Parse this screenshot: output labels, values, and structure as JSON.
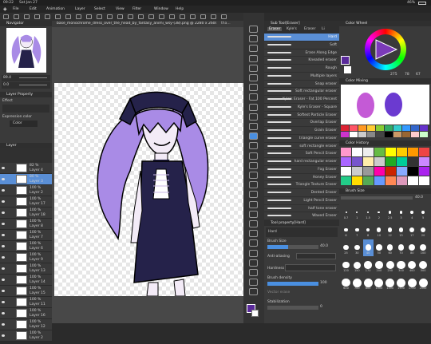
{
  "statusbar": {
    "time": "09:22",
    "date": "Sat Jan 27",
    "battery": "46%"
  },
  "menu": [
    "File",
    "Edit",
    "Animation",
    "Layer",
    "Select",
    "View",
    "Filter",
    "Window",
    "Help"
  ],
  "doc_tab": "base_monochrome_dress_over_the_head_by_fantasy_animi_wsy-(38).png @ 2280 x 2600 px, 96 dpi, 89.4%",
  "doc_tab2": "tha...",
  "navigator": {
    "title": "Navigator",
    "zoom": "89.4",
    "angle": "0.0"
  },
  "layer_property": {
    "title": "Layer Property",
    "effect": "Effect",
    "expression": "Expression color",
    "color": "Color"
  },
  "layers": {
    "title": "Layer",
    "items": [
      {
        "pct": "82 %",
        "name": "Layer 4"
      },
      {
        "pct": "80 %",
        "name": "Layer 3"
      },
      {
        "pct": "100 %",
        "name": "Layer 2"
      },
      {
        "pct": "100 %",
        "name": "Layer 17"
      },
      {
        "pct": "100 %",
        "name": "Layer 18"
      },
      {
        "pct": "100 %",
        "name": "Layer 8"
      },
      {
        "pct": "100 %",
        "name": "Layer 7"
      },
      {
        "pct": "100 %",
        "name": "Layer 6"
      },
      {
        "pct": "100 %",
        "name": "Layer 9"
      },
      {
        "pct": "100 %",
        "name": "Layer 13"
      },
      {
        "pct": "100 %",
        "name": "Layer 14"
      },
      {
        "pct": "100 %",
        "name": "Layer 15"
      },
      {
        "pct": "100 %",
        "name": "Layer 11"
      },
      {
        "pct": "100 %",
        "name": "Layer 16"
      },
      {
        "pct": "100 %",
        "name": "Layer 12"
      },
      {
        "pct": "100 %",
        "name": "Layer 2"
      }
    ]
  },
  "subtool": {
    "title": "Sub Tool[Eraser]",
    "tabs": [
      "Eraser",
      "Kyle's",
      "Eraser",
      "Li"
    ],
    "items": [
      "Hard",
      "Soft",
      "Erase Along Edge",
      "Kneaded eraser",
      "Rough",
      "Multiple layers",
      "Snap eraser",
      "Soft rectangular eraser",
      "Kyle's Eraser - Fat 100 Percent",
      "Kyle's Eraser - Square",
      "Softest Particle Eraser",
      "Overlap Eraser",
      "Grain Eraser",
      "triangle curve eraser",
      "soft rectangle eraser",
      "Soft Pencil Eraser",
      "hard rectangular eraser",
      "Fog Eraser",
      "Honey Eraser",
      "Triangle Texture Eraser",
      "Dented Eraser",
      "Light Pencil Eraser",
      "half tone eraser",
      "Waxed Eraser"
    ]
  },
  "tool_property": {
    "title": "Tool property[Hard]",
    "tool": "Hard",
    "brush_size_label": "Brush Size",
    "brush_size": "40.0",
    "anti_aliasing": "Anti-aliasing",
    "hardness": "Hardness",
    "brush_density": "Brush density",
    "brush_density_val": "100",
    "vector_erase": "Vector erase",
    "stabilization": "Stabilization",
    "stabilization_val": "0"
  },
  "color_wheel": {
    "title": "Color Wheel",
    "h": "275",
    "s": "78",
    "v": "67"
  },
  "color_mixing": {
    "title": "Color Mixing"
  },
  "color_history": {
    "title": "Color History"
  },
  "brush_size": {
    "title": "Brush Size",
    "value": "40.0",
    "sizes": [
      "0.7",
      "1",
      "1.5",
      "2",
      "2.5",
      "3",
      "4",
      "5",
      "6",
      "7",
      "8",
      "10",
      "12",
      "15",
      "17",
      "20",
      "25",
      "30",
      "40",
      "50",
      "60",
      "70",
      "80",
      "100",
      "120",
      "150",
      "170",
      "200",
      "250",
      "300",
      "400",
      "500",
      "600",
      "700",
      "800",
      "1000",
      "1200",
      "1500",
      "1700",
      "2000"
    ]
  },
  "colors": {
    "accent": "#4a8fe0",
    "main_color": "#5a2a9a",
    "sub_color": "#ffffff",
    "hair": "#a98be6",
    "dress": "#25224a"
  },
  "palette": [
    "#d23",
    "#f56",
    "#f92",
    "#fc3",
    "#8c3",
    "#3a6",
    "#3cc",
    "#39f",
    "#36c",
    "#63c",
    "#c3c",
    "#fff",
    "#ccc",
    "#888",
    "#444",
    "#000",
    "#c96",
    "#963",
    "#fcc",
    "#cfc"
  ],
  "history_colors": [
    "#f9c",
    "#fff",
    "#eee",
    "#6b4",
    "#ff0",
    "#fc0",
    "#f90",
    "#e44",
    "#a6f",
    "#75c",
    "#fea",
    "#ccc",
    "#2a2",
    "#0c9",
    "#333",
    "#c8f",
    "#fff",
    "#ccc",
    "#999",
    "#f0a",
    "#c20",
    "#8af",
    "#000",
    "#a2e",
    "#2c8",
    "#fd0",
    "#5a5",
    "#69f",
    "#f85",
    "#d9b",
    "#fff",
    "#fff"
  ]
}
